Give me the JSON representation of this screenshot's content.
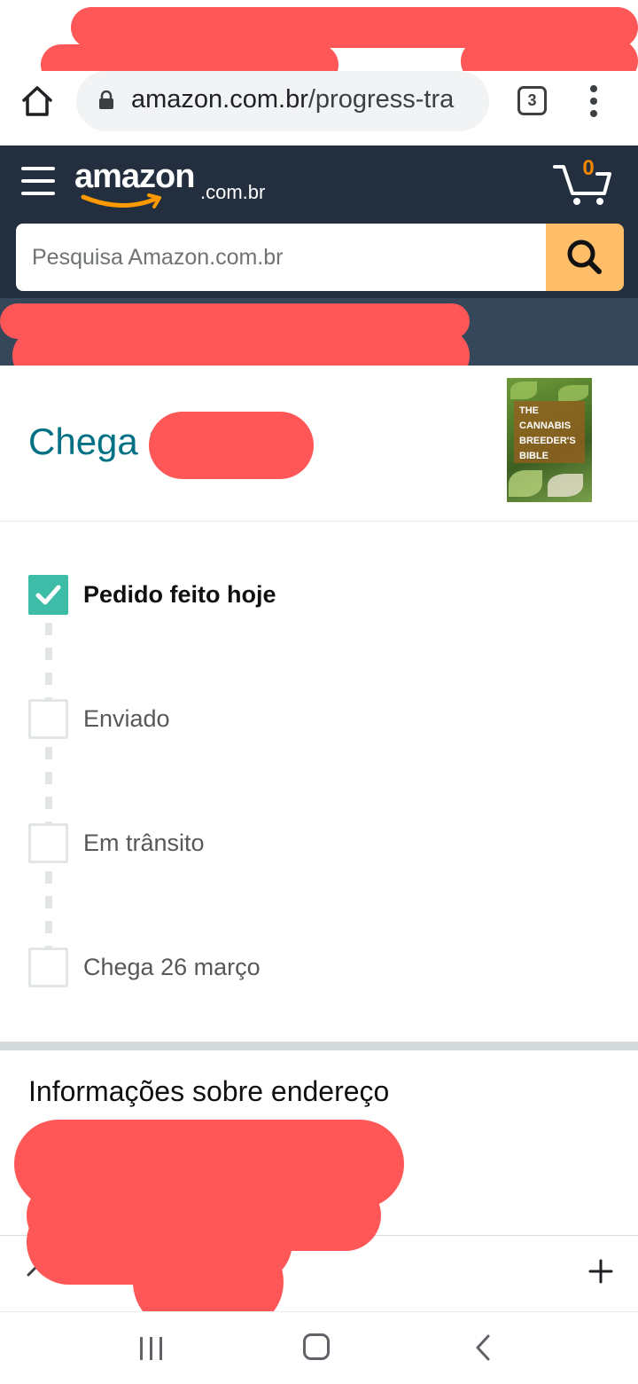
{
  "browser": {
    "url_domain": "amazon.com.br",
    "url_path": "/progress-tra",
    "tab_count": "3"
  },
  "header": {
    "logo_main": "amazon",
    "logo_suffix": ".com.br",
    "cart_count": "0",
    "search_placeholder": "Pesquisa Amazon.com.br"
  },
  "delivery": {
    "title": "Chega 2"
  },
  "product": {
    "cover_lines": [
      "THE",
      "CANNABIS",
      "BREEDER'S",
      "BIBLE"
    ]
  },
  "tracking": {
    "steps": [
      {
        "label": "Pedido feito hoje",
        "done": true
      },
      {
        "label": "Enviado",
        "done": false
      },
      {
        "label": "Em trânsito",
        "done": false
      },
      {
        "label": "Chega 26 março",
        "done": false
      }
    ]
  },
  "address": {
    "title": "Informações sobre endereço"
  },
  "colors": {
    "header_bg": "#232f3e",
    "substrip_bg": "#37475a",
    "search_button": "#febd69",
    "delivery_title": "#007185",
    "check_done": "#3dbda8",
    "cart_count": "#f08804",
    "redaction": "#ff5757"
  }
}
